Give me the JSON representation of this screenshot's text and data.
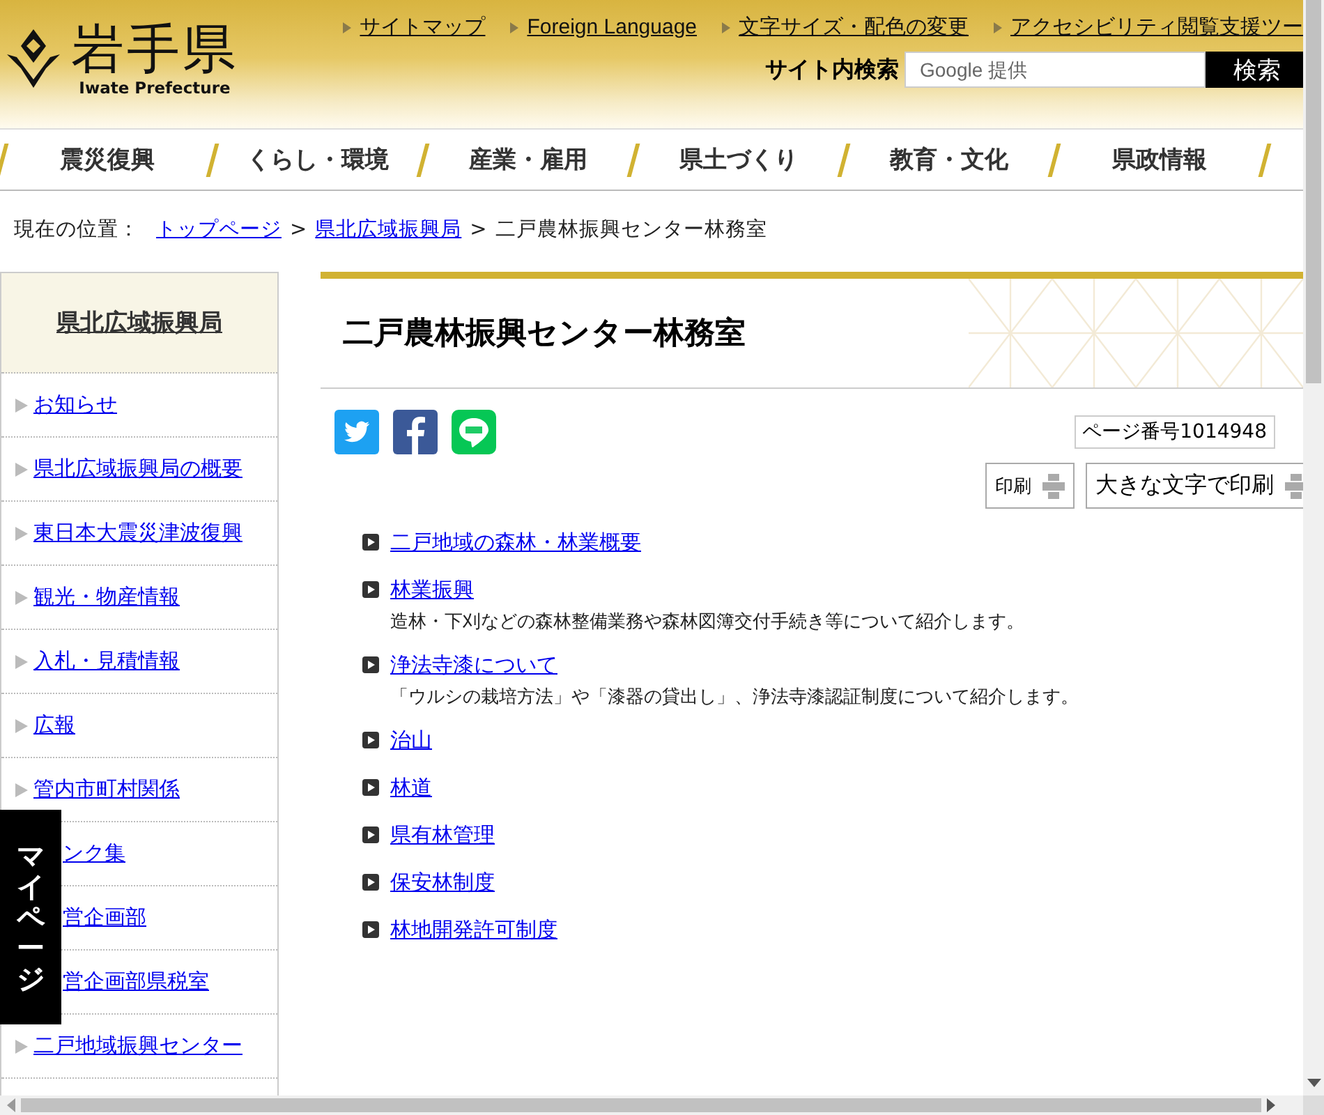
{
  "header": {
    "logo": {
      "name": "岩手県",
      "subtitle": "Iwate Prefecture"
    },
    "utility_links": [
      "サイトマップ",
      "Foreign Language",
      "文字サイズ・配色の変更",
      "アクセシビリティ閲覧支援ツー"
    ],
    "search": {
      "label": "サイト内検索",
      "placeholder": "Google 提供",
      "button": "検索"
    }
  },
  "nav": [
    "震災復興",
    "くらし・環境",
    "産業・雇用",
    "県土づくり",
    "教育・文化",
    "県政情報"
  ],
  "breadcrumb": {
    "label": "現在の位置：",
    "links": [
      "トップページ",
      "県北広域振興局"
    ],
    "separator": ">",
    "current": "二戸農林振興センター林務室"
  },
  "sidebar": {
    "heading": "県北広域振興局",
    "items": [
      {
        "label": "お知らせ",
        "kind": "link"
      },
      {
        "label": "県北広域振興局の概要",
        "kind": "link"
      },
      {
        "label": "東日本大震災津波復興",
        "kind": "link"
      },
      {
        "label": "観光・物産情報",
        "kind": "link"
      },
      {
        "label": "入札・見積情報",
        "kind": "link"
      },
      {
        "label": "広報",
        "kind": "link"
      },
      {
        "label": "管内市町村関係",
        "kind": "link"
      },
      {
        "label": "ンク集",
        "kind": "covered"
      },
      {
        "label": "営企画部",
        "kind": "covered"
      },
      {
        "label": "営企画部県税室",
        "kind": "covered"
      },
      {
        "label": "二戸地域振興センター",
        "kind": "link"
      }
    ]
  },
  "mypage_tab": "マイページ",
  "main": {
    "title": "二戸農林振興センター林務室",
    "page_number": "ページ番号1014948",
    "print_buttons": [
      "印刷",
      "大きな文字で印刷"
    ],
    "links": [
      {
        "label": "二戸地域の森林・林業概要"
      },
      {
        "label": "林業振興",
        "description": "造林・下刈などの森林整備業務や森林図簿交付手続き等について紹介します。"
      },
      {
        "label": "浄法寺漆について",
        "description": "「ウルシの栽培方法」や「漆器の貸出し」、浄法寺漆認証制度について紹介します。"
      },
      {
        "label": "治山"
      },
      {
        "label": "林道"
      },
      {
        "label": "県有林管理"
      },
      {
        "label": "保安林制度"
      },
      {
        "label": "林地開発許可制度"
      }
    ]
  }
}
